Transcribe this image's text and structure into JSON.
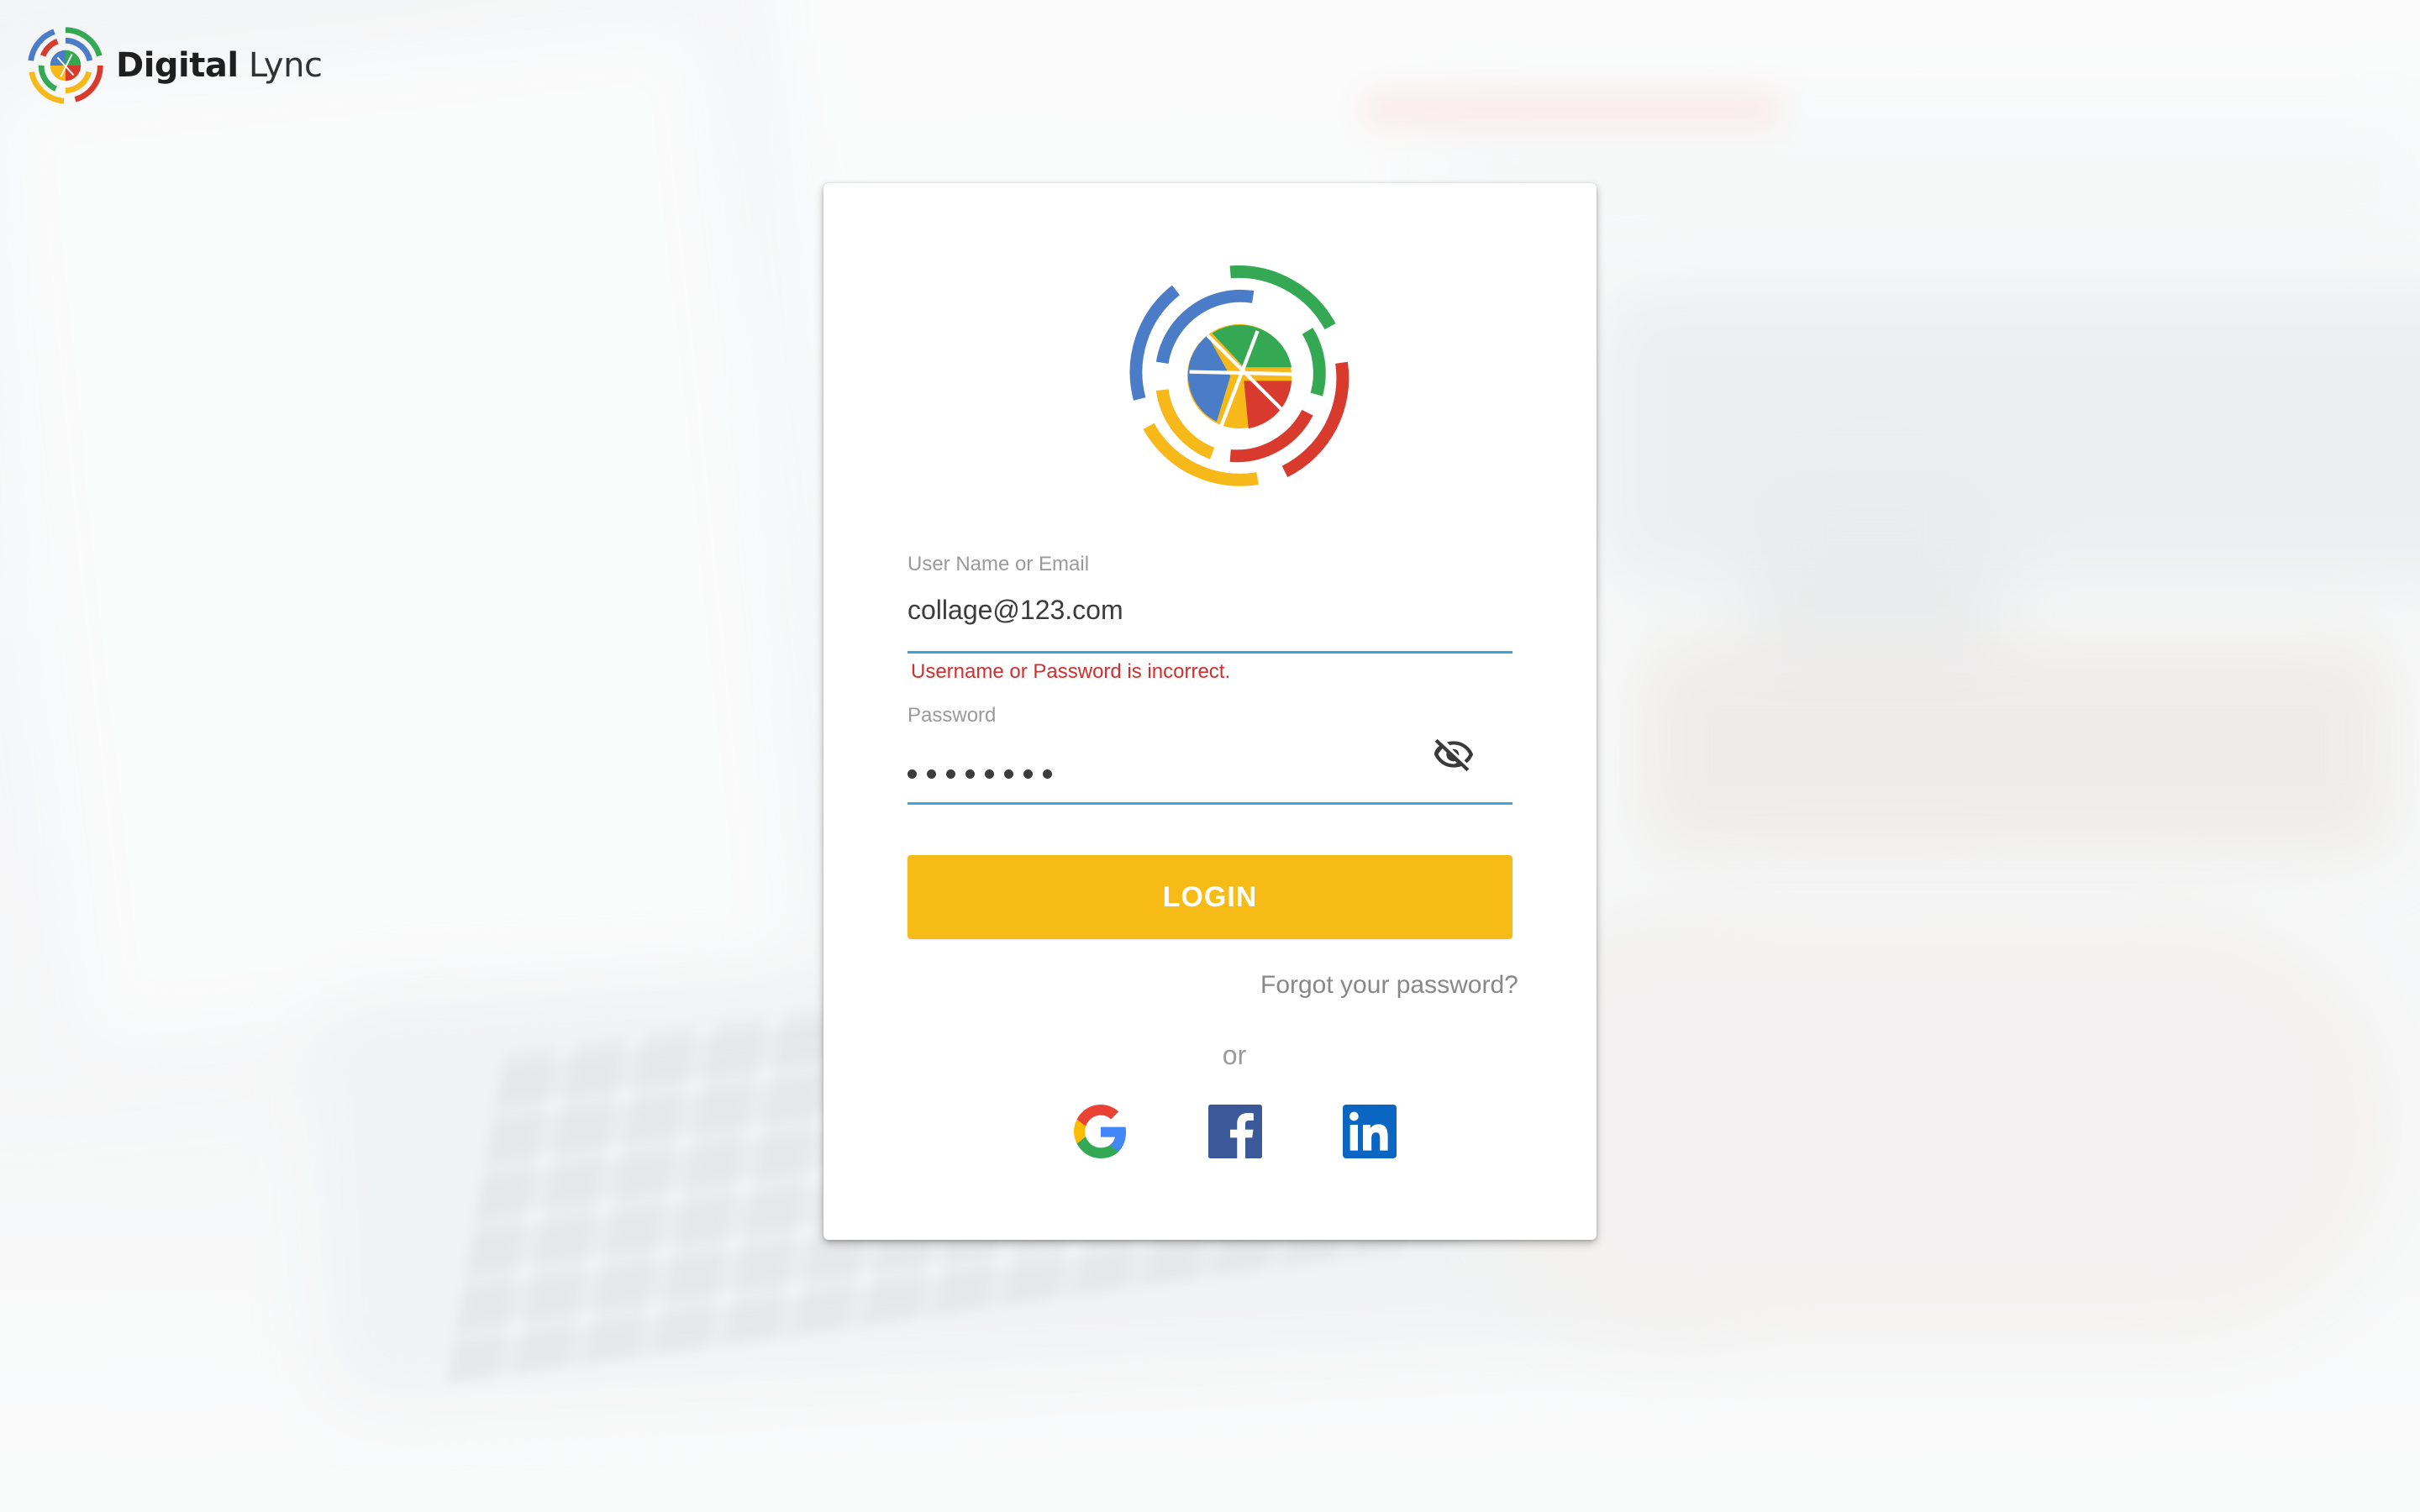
{
  "brand": {
    "name_bold": "Digital",
    "name_light": "Lync"
  },
  "login_form": {
    "username_label": "User Name or Email",
    "username_value": "collage@123.com",
    "error_message": "Username or Password is incorrect.",
    "password_label": "Password",
    "password_masked_length": 8,
    "login_button": "LOGIN",
    "forgot_password_link": "Forgot your password?",
    "divider_text": "or"
  },
  "social_logins": [
    {
      "name": "google",
      "icon": "google-icon"
    },
    {
      "name": "facebook",
      "icon": "facebook-icon"
    },
    {
      "name": "linkedin",
      "icon": "linkedin-icon"
    }
  ],
  "colors": {
    "accent_button": "#f7bb17",
    "input_underline": "#3fa2dc",
    "error": "#d32f2f",
    "logo_green": "#34a853",
    "logo_blue": "#4a7cc8",
    "logo_red": "#d93a2e",
    "logo_yellow": "#f6b919",
    "facebook": "#3b5998",
    "linkedin": "#0a66c2"
  }
}
